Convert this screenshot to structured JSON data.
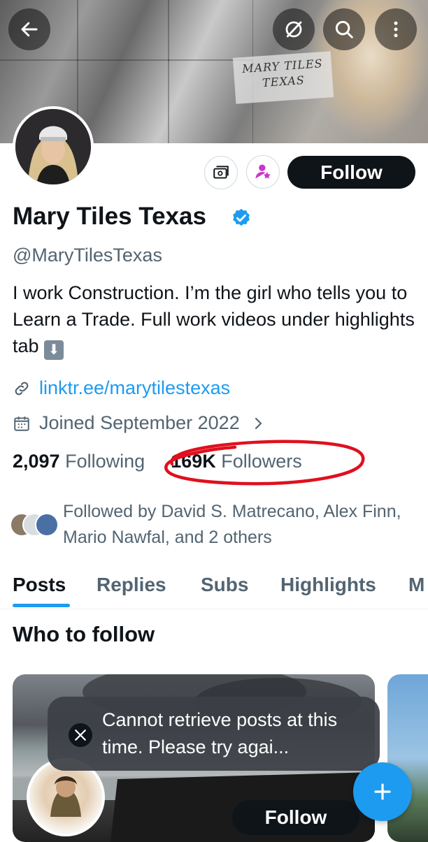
{
  "banner": {
    "watermark_line1": "MARY TILES",
    "watermark_line2": "TEXAS"
  },
  "icons": {
    "back": "arrow-left-icon",
    "grok": "grok-icon",
    "search": "search-icon",
    "more": "more-vertical-icon",
    "subscriptions": "subscription-ticket-icon",
    "creator": "creator-star-icon",
    "verified": "verified-badge-icon",
    "link": "link-icon",
    "calendar": "calendar-icon",
    "chevron": "chevron-right-icon",
    "x": "x-logo-icon",
    "compose": "plus-icon"
  },
  "colors": {
    "accent": "#1d9bf0",
    "text": "#0f1419",
    "secondary": "#536471",
    "highlight_circle": "#e0101e"
  },
  "profile": {
    "follow_label": "Follow",
    "name": "Mary Tiles Texas",
    "handle": "@MaryTilesTexas",
    "bio_text": "I work Construction. I’m the girl who tells you to Learn a Trade.  Full work videos under highlights tab ",
    "bio_emoji": "⬇",
    "link": "linktr.ee/marytilestexas",
    "joined": "Joined September 2022",
    "following_count": "2,097",
    "following_label": "Following",
    "followers_count": "169K",
    "followers_label": "Followers",
    "followed_by": "Followed by David S. Matrecano, Alex Finn, Mario Nawfal, and 2 others"
  },
  "tabs": [
    {
      "label": "Posts",
      "active": true
    },
    {
      "label": "Replies",
      "active": false
    },
    {
      "label": "Subs",
      "active": false
    },
    {
      "label": "Highlights",
      "active": false
    },
    {
      "label": "M",
      "active": false
    }
  ],
  "who_to_follow": {
    "title": "Who to follow",
    "follow_label": "Follow"
  },
  "toast": {
    "message": "Cannot retrieve posts at this time. Please try agai..."
  }
}
